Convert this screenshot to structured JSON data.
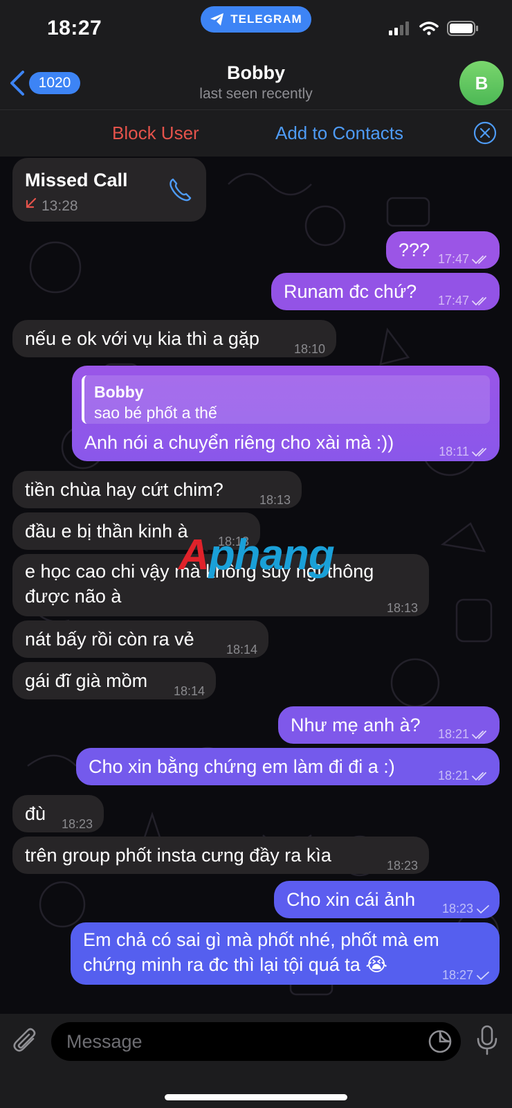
{
  "status_bar": {
    "time": "18:27",
    "app_pill": "TELEGRAM"
  },
  "header": {
    "back_count": "1020",
    "title": "Bobby",
    "subtitle": "last seen recently",
    "avatar_initial": "B"
  },
  "action_bar": {
    "block_label": "Block User",
    "add_label": "Add to Contacts"
  },
  "missed_call": {
    "label": "Missed Call",
    "time": "13:28"
  },
  "messages": [
    {
      "dir": "out",
      "text": "???",
      "time": "17:47"
    },
    {
      "dir": "out",
      "text": "Runam đc chứ?",
      "time": "17:47"
    },
    {
      "dir": "in",
      "text": "nếu e ok với vụ kia thì a gặp",
      "time": "18:10"
    },
    {
      "dir": "out",
      "reply_name": "Bobby",
      "reply_text": "sao bé phốt a thế",
      "text": "Anh nói a chuyển riêng cho xài mà :))",
      "time": "18:11"
    },
    {
      "dir": "in",
      "text": "tiền chùa hay cứt chim?",
      "time": "18:13"
    },
    {
      "dir": "in",
      "text": "đầu e bị thần kinh à",
      "time": "18:13"
    },
    {
      "dir": "in",
      "line1": "e học cao chi vậy mà không suy ngĩ thông",
      "line2": "được não à",
      "time": "18:13"
    },
    {
      "dir": "in",
      "text": "nát bấy rồi còn ra vẻ",
      "time": "18:14"
    },
    {
      "dir": "in",
      "text": "gái đĩ già mồm",
      "time": "18:14"
    },
    {
      "dir": "out",
      "text": "Như mẹ anh à?",
      "time": "18:21"
    },
    {
      "dir": "out",
      "text": "Cho xin bằng chứng em làm đi đi a :)",
      "time": "18:21"
    },
    {
      "dir": "in",
      "text": "đù",
      "time": "18:23"
    },
    {
      "dir": "in",
      "text": "trên group phốt insta cưng đầy ra kìa",
      "time": "18:23"
    },
    {
      "dir": "out",
      "text": "Cho xin cái ảnh",
      "time": "18:23"
    },
    {
      "dir": "out",
      "line1": "Em chả có sai gì mà phốt nhé, phốt mà em",
      "line2": "chứng minh ra đc thì lại tội quá ta",
      "emoji": "😭",
      "time": "18:27"
    }
  ],
  "watermark": {
    "part1": "A",
    "part2": "phang"
  },
  "input": {
    "placeholder": "Message"
  },
  "colors": {
    "accent": "#3d84f5",
    "danger": "#e5534b",
    "out_top": "#9b55e6",
    "out_bottom": "#5561ee",
    "in_bubble": "#272527"
  },
  "icons": [
    "signal-icon",
    "wifi-icon",
    "battery-icon",
    "back-chevron-icon",
    "close-circle-icon",
    "phone-icon",
    "missed-call-arrow-icon",
    "read-checks-icon",
    "attach-icon",
    "sticker-icon",
    "mic-icon",
    "telegram-plane-icon"
  ]
}
